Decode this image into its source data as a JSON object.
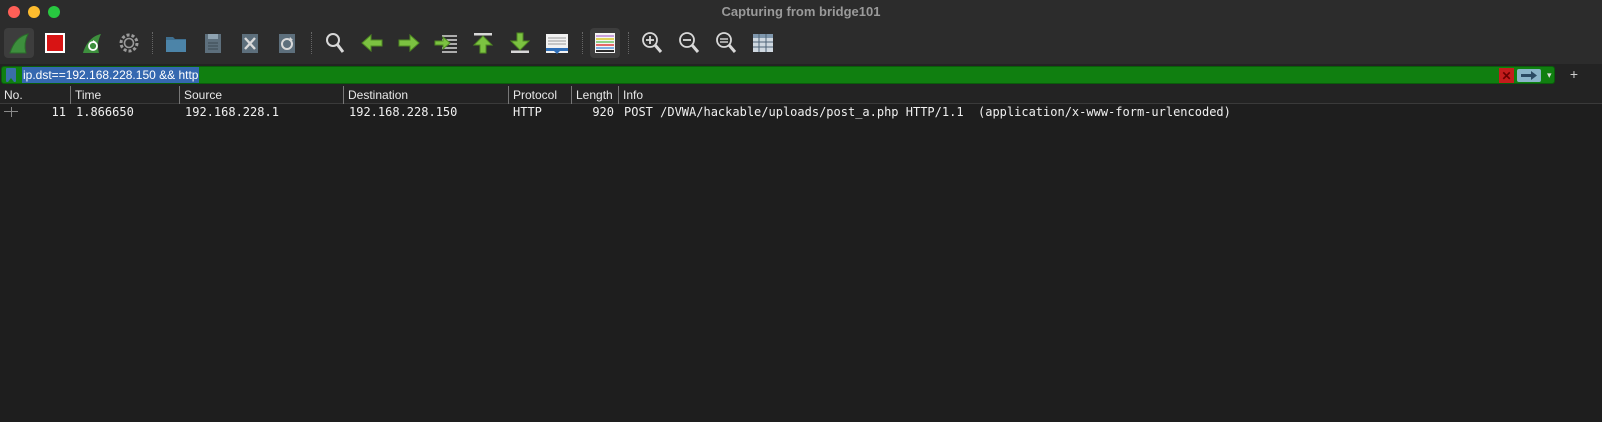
{
  "window": {
    "title": "Capturing from bridge101"
  },
  "toolbar": {
    "buttons": [
      {
        "icon": "shark-fin-start-icon"
      },
      {
        "icon": "stop-capture-icon"
      },
      {
        "icon": "restart-capture-icon"
      },
      {
        "icon": "capture-options-gear-icon"
      },
      {
        "icon": "open-file-folder-icon"
      },
      {
        "icon": "save-file-icon"
      },
      {
        "icon": "close-file-icon"
      },
      {
        "icon": "reload-file-icon"
      },
      {
        "icon": "find-packet-icon"
      },
      {
        "icon": "go-back-icon"
      },
      {
        "icon": "go-forward-icon"
      },
      {
        "icon": "go-to-packet-icon"
      },
      {
        "icon": "go-first-packet-icon"
      },
      {
        "icon": "go-last-packet-icon"
      },
      {
        "icon": "auto-scroll-icon"
      },
      {
        "icon": "colorize-icon"
      },
      {
        "icon": "zoom-in-icon"
      },
      {
        "icon": "zoom-out-icon"
      },
      {
        "icon": "normal-size-icon"
      },
      {
        "icon": "resize-columns-icon"
      }
    ]
  },
  "filter": {
    "value": "ip.dst==192.168.228.150 && http",
    "add_label": "+",
    "colors": {
      "valid_bg": "#107f10",
      "selection": "#3568b0"
    }
  },
  "packet_list": {
    "columns": [
      "No.",
      "Time",
      "Source",
      "Destination",
      "Protocol",
      "Length",
      "Info"
    ],
    "rows": [
      {
        "no": "11",
        "time": "1.866650",
        "source": "192.168.228.1",
        "destination": "192.168.228.150",
        "protocol": "HTTP",
        "length": "920",
        "info": "POST /DVWA/hackable/uploads/post_a.php HTTP/1.1  (application/x-www-form-urlencoded)"
      }
    ]
  }
}
